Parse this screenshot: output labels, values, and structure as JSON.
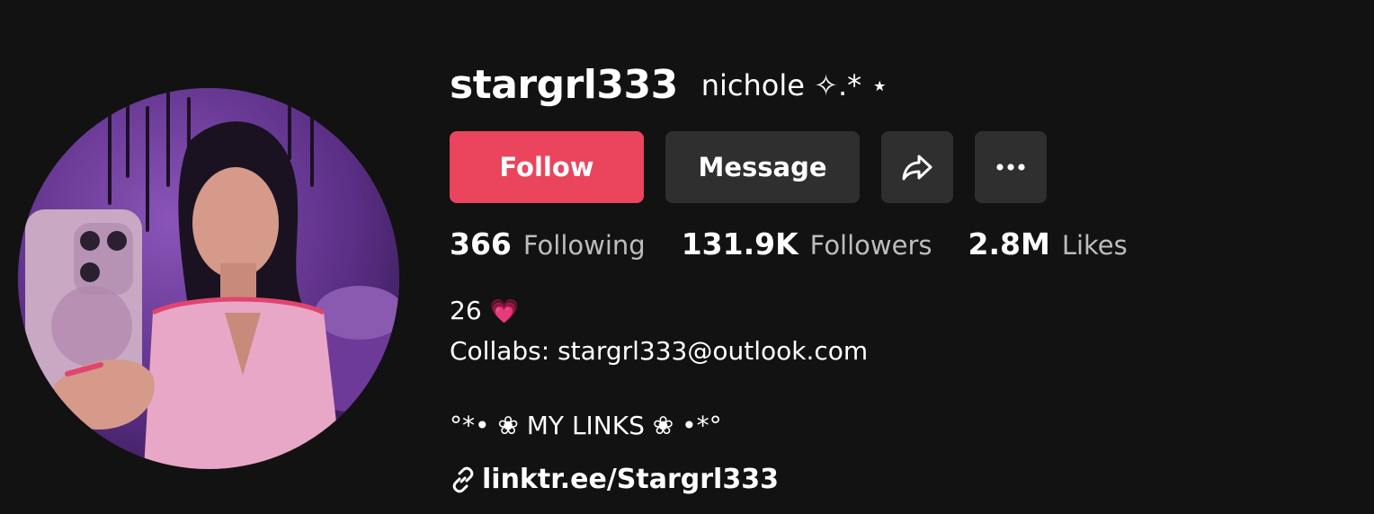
{
  "profile": {
    "username": "stargrl333",
    "nickname": "nichole ✧.* ⋆"
  },
  "actions": {
    "follow_label": "Follow",
    "message_label": "Message",
    "share_icon": "share-icon",
    "more_icon": "more-icon"
  },
  "stats": [
    {
      "value": "366",
      "label": "Following"
    },
    {
      "value": "131.9K",
      "label": "Followers"
    },
    {
      "value": "2.8M",
      "label": "Likes"
    }
  ],
  "bio": {
    "line1_text": "26",
    "line1_emoji": "💗",
    "line2": "Collabs: stargrl333@outlook.com",
    "line3": "°*• ❀ MY LINKS ❀ •*°"
  },
  "link": {
    "text": "linktr.ee/Stargrl333",
    "icon": "link-icon"
  },
  "colors": {
    "background": "#121212",
    "follow": "#ea455d",
    "secondary_button": "#2f2f2f",
    "muted_text": "#bdbdbd"
  }
}
